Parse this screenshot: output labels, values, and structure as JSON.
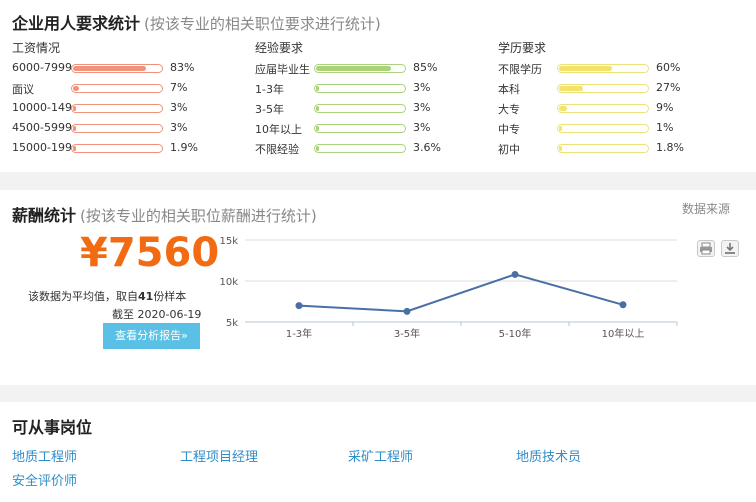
{
  "stats": {
    "title": "企业用人要求统计",
    "subtitle": "(按该专业的相关职位要求进行统计)",
    "columns": [
      {
        "title": "工资情况",
        "rows": [
          {
            "label": "6000-7999",
            "pct": "83%",
            "value": 0.83
          },
          {
            "label": "面议",
            "pct": "7%",
            "value": 0.07
          },
          {
            "label": "10000-149",
            "pct": "3%",
            "value": 0.03
          },
          {
            "label": "4500-5999",
            "pct": "3%",
            "value": 0.03
          },
          {
            "label": "15000-199",
            "pct": "1.9%",
            "value": 0.019
          }
        ]
      },
      {
        "title": "经验要求",
        "rows": [
          {
            "label": "应届毕业生",
            "pct": "85%",
            "value": 0.85
          },
          {
            "label": "1-3年",
            "pct": "3%",
            "value": 0.03
          },
          {
            "label": "3-5年",
            "pct": "3%",
            "value": 0.03
          },
          {
            "label": "10年以上",
            "pct": "3%",
            "value": 0.03
          },
          {
            "label": "不限经验",
            "pct": "3.6%",
            "value": 0.036
          }
        ]
      },
      {
        "title": "学历要求",
        "rows": [
          {
            "label": "不限学历",
            "pct": "60%",
            "value": 0.6
          },
          {
            "label": "本科",
            "pct": "27%",
            "value": 0.27
          },
          {
            "label": "大专",
            "pct": "9%",
            "value": 0.09
          },
          {
            "label": "中专",
            "pct": "1%",
            "value": 0.01
          },
          {
            "label": "初中",
            "pct": "1.8%",
            "value": 0.018
          }
        ]
      }
    ]
  },
  "salary": {
    "title": "薪酬统计",
    "subtitle": "(按该专业的相关职位薪酬进行统计)",
    "source": "数据来源",
    "amount": "¥7560",
    "note_prefix": "该数据为平均值，取自",
    "sample_count": "41",
    "note_suffix": "份样本",
    "cutoff": "截至 2020-06-19",
    "report_button": "查看分析报告»",
    "tools": [
      "print-icon",
      "download-icon"
    ]
  },
  "chart_data": {
    "type": "line",
    "categories": [
      "1-3年",
      "3-5年",
      "5-10年",
      "10年以上"
    ],
    "series": [
      {
        "values": [
          7000,
          6300,
          10800,
          7100
        ]
      }
    ],
    "yticks": [
      "5k",
      "10k",
      "15k"
    ],
    "ylim": [
      5000,
      15000
    ],
    "grid": true,
    "color": "#4a6fa5"
  },
  "positions": {
    "title": "可从事岗位",
    "items": [
      "地质工程师",
      "工程项目经理",
      "采矿工程师",
      "地质技术员",
      "安全评价师"
    ]
  }
}
